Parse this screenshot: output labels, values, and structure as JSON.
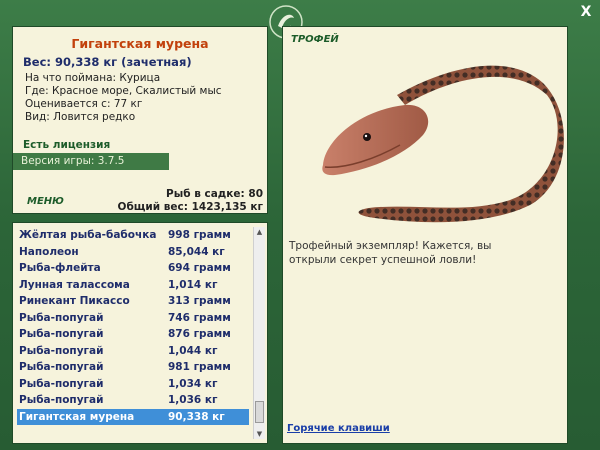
{
  "window": {
    "close_label": "X"
  },
  "fish": {
    "name": "Гигантская мурена",
    "weight_line": "Вес: 90,338 кг (зачетная)",
    "bait_line": "На что поймана: Курица",
    "location_line": "Где: Красное море, Скалистый мыс",
    "value_line": "Оценивается с: 77 кг",
    "kind_line": "Вид: Ловится редко"
  },
  "license_label": "Есть лицензия",
  "version_label": "Версия игры: 3.7.5",
  "menu_label": "МЕНЮ",
  "stats": {
    "fish_in_keepnet": "Рыб в садке: 80",
    "total_weight": "Общий вес: 1423,135 кг"
  },
  "catch_list": [
    {
      "name": "Жёлтая рыба-бабочка",
      "weight": "998 грамм"
    },
    {
      "name": "Наполеон",
      "weight": "85,044 кг"
    },
    {
      "name": "Рыба-флейта",
      "weight": "694 грамм"
    },
    {
      "name": "Лунная талассома",
      "weight": "1,014 кг"
    },
    {
      "name": "Ринекант Пикассо",
      "weight": "313 грамм"
    },
    {
      "name": "Рыба-попугай",
      "weight": "746 грамм"
    },
    {
      "name": "Рыба-попугай",
      "weight": "876 грамм"
    },
    {
      "name": "Рыба-попугай",
      "weight": "1,044 кг"
    },
    {
      "name": "Рыба-попугай",
      "weight": "981 грамм"
    },
    {
      "name": "Рыба-попугай",
      "weight": "1,034 кг"
    },
    {
      "name": "Рыба-попугай",
      "weight": "1,036 кг"
    },
    {
      "name": "Гигантская мурена",
      "weight": "90,338 кг",
      "selected": true
    }
  ],
  "trophy": {
    "label": "ТРОФЕЙ",
    "text": "Трофейный экземпляр! Кажется, вы открыли секрет успешной ловли!",
    "hotkeys_link": "Горячие клавиши"
  },
  "colors": {
    "frame": "#2f6b3c",
    "panel": "#f6f3dc",
    "title": "#c2410c",
    "selection": "#3f8fd8"
  }
}
